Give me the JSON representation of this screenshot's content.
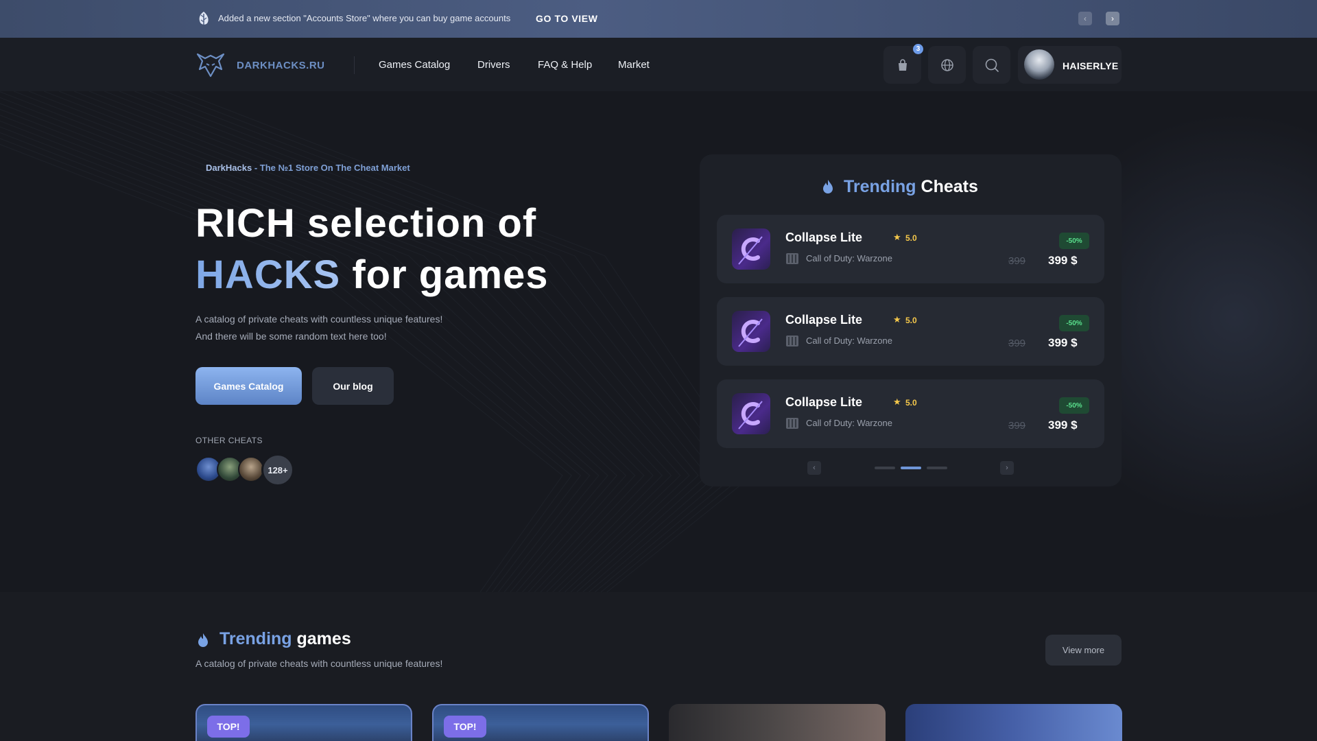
{
  "announcement": {
    "text": "Added a new section \"Accounts Store\" where you can buy game accounts",
    "cta": "GO TO VIEW",
    "prev_icon": "chevron-left-icon",
    "next_icon": "chevron-right-icon"
  },
  "header": {
    "logo_text": "DARKHACKS.RU",
    "nav": [
      "Games Catalog",
      "Drivers",
      "FAQ & Help",
      "Market"
    ],
    "cart_count": "3",
    "username": "HAISERLYE"
  },
  "hero": {
    "tagline_brand": "DarkHacks",
    "tagline_rest": " - The №1 Store On The Cheat Market",
    "title_line1": "RICH selection of",
    "title_accent": "HACKS",
    "title_line2_rest": " for games",
    "desc_line1": "A catalog of private cheats with countless unique features!",
    "desc_line2": "And there will be some random text here too!",
    "primary_button": "Games Catalog",
    "secondary_button": "Our blog",
    "other_label": "OTHER CHEATS",
    "other_count": "128+"
  },
  "trending_cheats": {
    "title_accent": "Trending",
    "title_rest": " Cheats",
    "items": [
      {
        "name": "Collapse Lite",
        "rating": "5.0",
        "game": "Call of Duty: Warzone",
        "discount": "-50%",
        "old_price": "399",
        "price": "399 $"
      },
      {
        "name": "Collapse Lite",
        "rating": "5.0",
        "game": "Call of Duty: Warzone",
        "discount": "-50%",
        "old_price": "399",
        "price": "399 $"
      },
      {
        "name": "Collapse Lite",
        "rating": "5.0",
        "game": "Call of Duty: Warzone",
        "discount": "-50%",
        "old_price": "399",
        "price": "399 $"
      }
    ],
    "pagination_active": 2,
    "pagination_total": 3
  },
  "trending_games": {
    "title_accent": "Trending",
    "title_rest": " games",
    "desc": "A catalog of private cheats with countless unique features!",
    "view_more": "View more",
    "badges": [
      "TOP!",
      "TOP!"
    ]
  },
  "colors": {
    "accent": "#79a2e4",
    "background": "#17191f",
    "discount": "#5ae08d",
    "star": "#f5c84b"
  }
}
